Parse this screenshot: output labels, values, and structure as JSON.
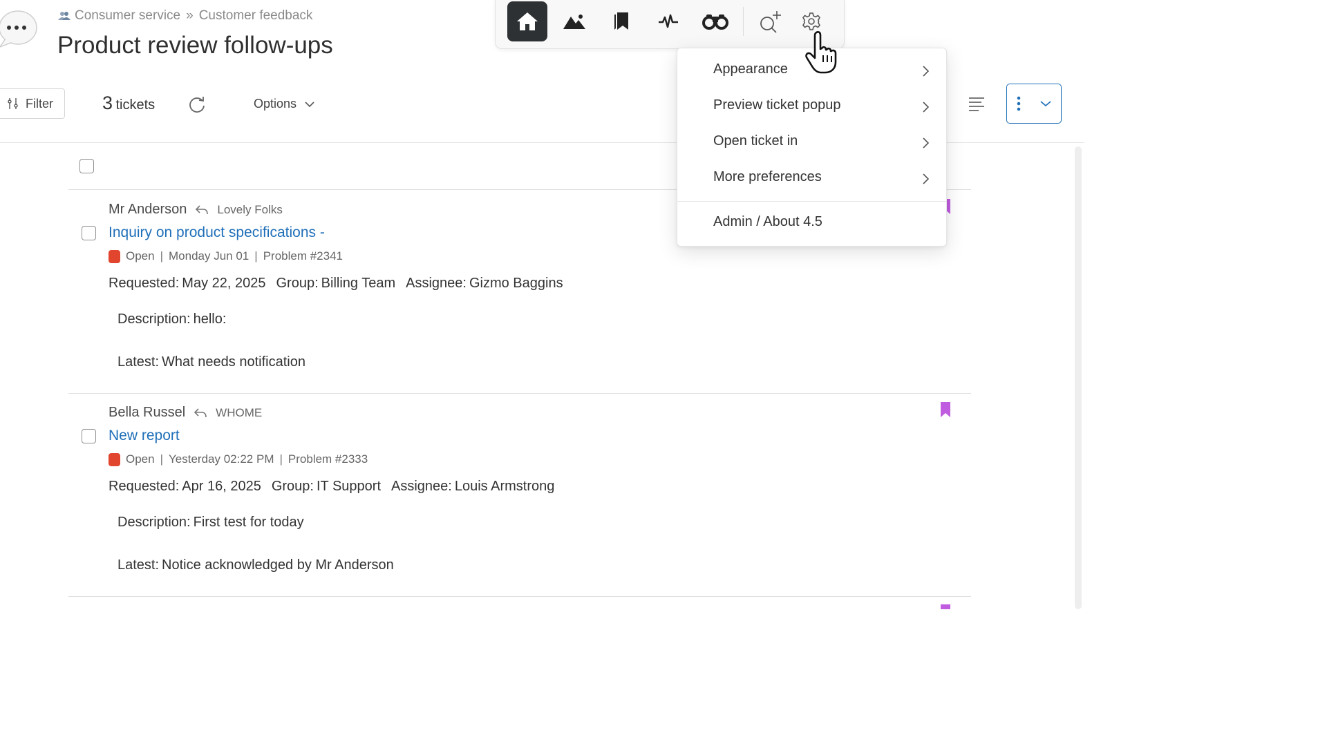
{
  "breadcrumb": {
    "section": "Consumer service",
    "separator": "»",
    "view": "Customer feedback"
  },
  "page_title": "Product review follow-ups",
  "nav": {
    "items": [
      {
        "name": "home",
        "icon": "home-icon",
        "active": true
      },
      {
        "name": "landscape",
        "icon": "mountain-icon",
        "active": false
      },
      {
        "name": "bookmarks",
        "icon": "bookmark-icon",
        "active": false
      },
      {
        "name": "activity",
        "icon": "activity-icon",
        "active": false
      },
      {
        "name": "binoculars",
        "icon": "binoculars-icon",
        "active": false
      },
      {
        "name": "add-search",
        "icon": "search-plus-icon",
        "active": false
      },
      {
        "name": "settings",
        "icon": "gear-icon",
        "active": false
      }
    ]
  },
  "toolbar": {
    "filter_label": "Filter",
    "ticket_count": "3",
    "ticket_count_label": "tickets",
    "options_label": "Options"
  },
  "tickets": [
    {
      "requester": "Mr Anderson",
      "organization": "Lovely Folks",
      "subject": "Inquiry on product specifications -",
      "status": "Open",
      "updated": "Monday Jun 01",
      "type": "Problem #2341",
      "requested_label": "Requested:",
      "requested": "May 22, 2025",
      "group_label": "Group:",
      "group": "Billing Team",
      "assignee_label": "Assignee:",
      "assignee": "Gizmo Baggins",
      "description_label": "Description:",
      "description": "hello:",
      "latest_label": "Latest:",
      "latest": "What needs notification"
    },
    {
      "requester": "Bella Russel",
      "organization": "WHOME",
      "subject": "New report",
      "status": "Open",
      "updated": "Yesterday 02:22 PM",
      "type": "Problem #2333",
      "requested_label": "Requested:",
      "requested": "Apr 16, 2025",
      "group_label": "Group:",
      "group": "IT Support",
      "assignee_label": "Assignee:",
      "assignee": "Louis Armstrong",
      "description_label": "Description:",
      "description": "First test for today",
      "latest_label": "Latest:",
      "latest": "Notice acknowledged by Mr Anderson"
    }
  ],
  "settings_menu": {
    "items": [
      {
        "label": "Appearance",
        "has_submenu": true
      },
      {
        "label": "Preview ticket popup",
        "has_submenu": true
      },
      {
        "label": "Open ticket in",
        "has_submenu": true
      },
      {
        "label": "More preferences",
        "has_submenu": true
      },
      {
        "label": "Admin / About 4.5",
        "has_submenu": false
      }
    ]
  },
  "colors": {
    "accent_blue": "#1f6fb8",
    "status_open": "#e2452e",
    "bookmark": "#c05ce0",
    "nav_active": "#2d3133"
  }
}
